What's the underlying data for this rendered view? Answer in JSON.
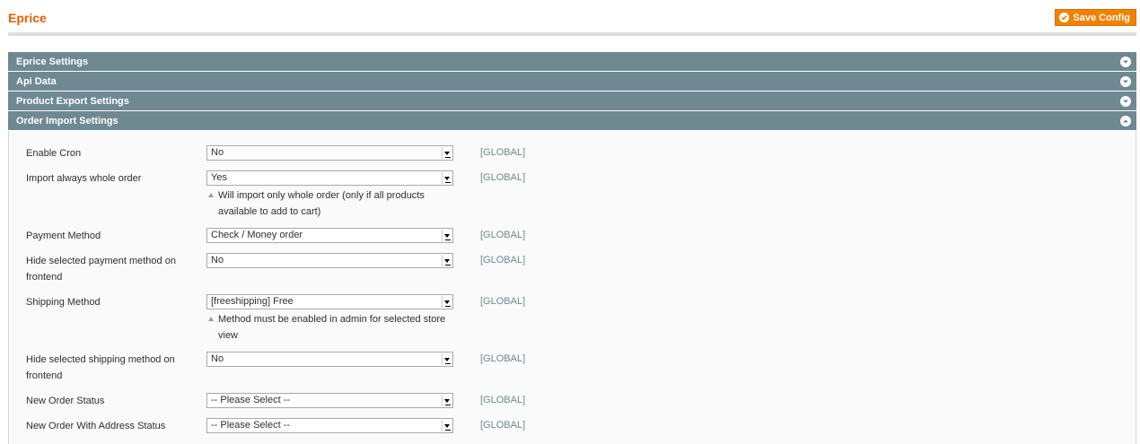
{
  "header": {
    "title": "Eprice",
    "save_label": "Save Config"
  },
  "sections": [
    {
      "label": "Eprice Settings",
      "state": "collapsed"
    },
    {
      "label": "Api Data",
      "state": "collapsed"
    },
    {
      "label": "Product Export Settings",
      "state": "collapsed"
    },
    {
      "label": "Order Import Settings",
      "state": "expanded"
    }
  ],
  "fields": [
    {
      "label": "Enable Cron",
      "value": "No",
      "scope": "[GLOBAL]"
    },
    {
      "label": "Import always whole order",
      "value": "Yes",
      "scope": "[GLOBAL]",
      "note": "Will import only whole order (only if all products available to add to cart)"
    },
    {
      "label": "Payment Method",
      "value": "Check / Money order",
      "scope": "[GLOBAL]"
    },
    {
      "label": "Hide selected payment method on frontend",
      "value": "No",
      "scope": "[GLOBAL]"
    },
    {
      "label": "Shipping Method",
      "value": "[freeshipping] Free",
      "scope": "[GLOBAL]",
      "note": "Method must be enabled in admin for selected store view"
    },
    {
      "label": "Hide selected shipping method on frontend",
      "value": "No",
      "scope": "[GLOBAL]"
    },
    {
      "label": "New Order Status",
      "value": "-- Please Select --",
      "scope": "[GLOBAL]"
    },
    {
      "label": "New Order With Address Status",
      "value": "-- Please Select --",
      "scope": "[GLOBAL]"
    }
  ],
  "icons": {
    "save": "check-circle-icon",
    "collapsed": "chevron-down-circle-icon",
    "expanded": "chevron-up-circle-icon",
    "dropdown": "dropdown-arrow-icon",
    "note": "note-triangle-icon"
  },
  "colors": {
    "title": "#eb5e00",
    "button": "#f18200",
    "section_header": "#6f8992",
    "scope_text": "#6f8992"
  }
}
